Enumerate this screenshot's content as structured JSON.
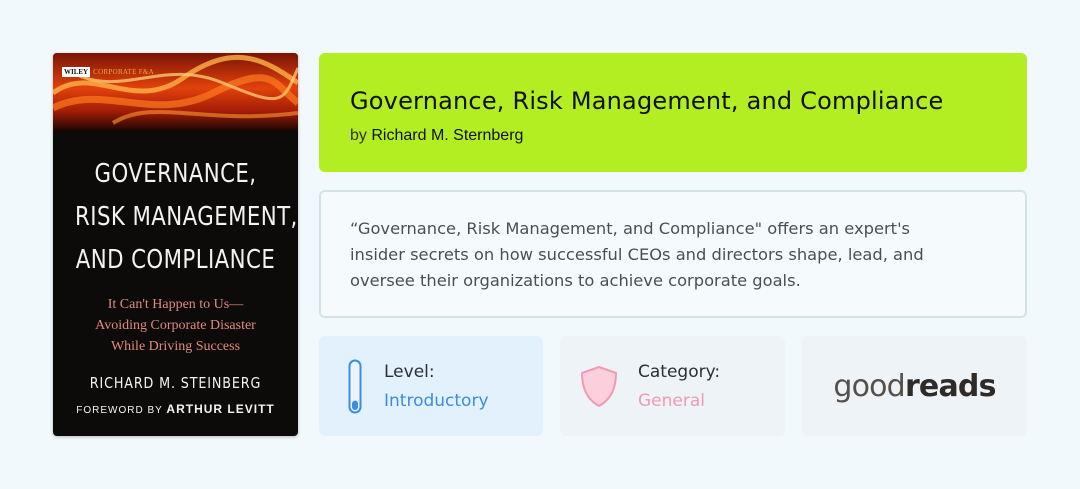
{
  "cover": {
    "publisher": "WILEY",
    "series": "CORPORATE F&A",
    "title_lines": [
      "GOVERNANCE,",
      "RISK MANAGEMENT,",
      "AND COMPLIANCE"
    ],
    "subtitle_lines": [
      "It Can't Happen to Us—",
      "Avoiding Corporate Disaster",
      "While Driving Success"
    ],
    "author": "RICHARD M. STEINBERG",
    "foreword_prefix": "FOREWORD BY",
    "foreword_name": "ARTHUR LEVITT"
  },
  "book": {
    "title": "Governance, Risk Management, and Compliance",
    "by_prefix": "by",
    "author": "Richard M. Sternberg",
    "description": "“Governance, Risk Management, and Compliance\" offers an expert's insider secrets on how successful CEOs and directors shape, lead, and oversee their organizations to achieve corporate goals."
  },
  "level": {
    "label": "Level:",
    "value": "Introductory",
    "icon": "thermometer-icon",
    "fill_fraction": 0.2
  },
  "category": {
    "label": "Category:",
    "value": "General",
    "icon": "shield-icon"
  },
  "goodreads": {
    "part1": "good",
    "part2": "reads"
  },
  "colors": {
    "title_card_bg": "#b2ee21",
    "level_accent": "#3a8de0",
    "category_accent": "#f19ab2"
  }
}
